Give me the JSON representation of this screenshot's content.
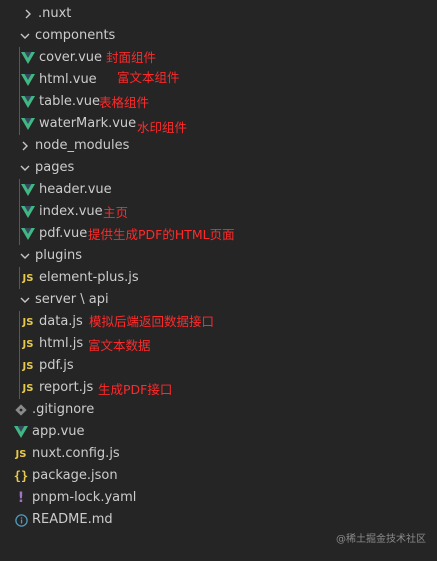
{
  "explorer": {
    "items": [
      {
        "label": ".nuxt",
        "icon": "chevron-right-icon",
        "chevron": "right",
        "kind": "folder"
      },
      {
        "label": "components",
        "icon": "chevron-down-icon",
        "chevron": "down",
        "kind": "folder"
      },
      {
        "label": "cover.vue",
        "icon": "vue-icon",
        "kind": "vue",
        "note": "封面组件"
      },
      {
        "label": "html.vue",
        "icon": "vue-icon",
        "kind": "vue",
        "note": "富文本组件"
      },
      {
        "label": "table.vue",
        "icon": "vue-icon",
        "kind": "vue",
        "note": "表格组件"
      },
      {
        "label": "waterMark.vue",
        "icon": "vue-icon",
        "kind": "vue",
        "note": "水印组件"
      },
      {
        "label": "node_modules",
        "icon": "chevron-right-icon",
        "chevron": "right",
        "kind": "folder"
      },
      {
        "label": "pages",
        "icon": "chevron-down-icon",
        "chevron": "down",
        "kind": "folder"
      },
      {
        "label": "header.vue",
        "icon": "vue-icon",
        "kind": "vue"
      },
      {
        "label": "index.vue",
        "icon": "vue-icon",
        "kind": "vue",
        "note": "主页"
      },
      {
        "label": "pdf.vue",
        "icon": "vue-icon",
        "kind": "vue",
        "note": "提供生成PDF的HTML页面"
      },
      {
        "label": "plugins",
        "icon": "chevron-down-icon",
        "chevron": "down",
        "kind": "folder"
      },
      {
        "label": "element-plus.js",
        "icon": "js-icon",
        "kind": "js"
      },
      {
        "label": "server \\ api",
        "icon": "chevron-down-icon",
        "chevron": "down",
        "kind": "folder"
      },
      {
        "label": "data.js",
        "icon": "js-icon",
        "kind": "js",
        "note": "模拟后端返回数据接口"
      },
      {
        "label": "html.js",
        "icon": "js-icon",
        "kind": "js",
        "note": "富文本数据"
      },
      {
        "label": "pdf.js",
        "icon": "js-icon",
        "kind": "js"
      },
      {
        "label": "report.js",
        "icon": "js-icon",
        "kind": "js",
        "note": "生成PDF接口"
      },
      {
        "label": ".gitignore",
        "icon": "git-icon",
        "kind": "git"
      },
      {
        "label": "app.vue",
        "icon": "vue-icon",
        "kind": "vue"
      },
      {
        "label": "nuxt.config.js",
        "icon": "js-icon",
        "kind": "js"
      },
      {
        "label": "package.json",
        "icon": "json-icon",
        "kind": "json"
      },
      {
        "label": "pnpm-lock.yaml",
        "icon": "yaml-icon",
        "kind": "yaml"
      },
      {
        "label": "README.md",
        "icon": "info-icon",
        "kind": "info"
      }
    ]
  },
  "icons": {
    "js_text": "JS",
    "json_text": "{}",
    "yaml_text": "!"
  },
  "colors": {
    "background": "#252526",
    "text": "#cccccc",
    "annotation": "#ff2a2a",
    "vue": "#41b883",
    "js": "#e8c94b",
    "yaml": "#a074c4",
    "info": "#519aba",
    "git": "#8a8a8a"
  },
  "watermark": "@稀土掘金技术社区"
}
